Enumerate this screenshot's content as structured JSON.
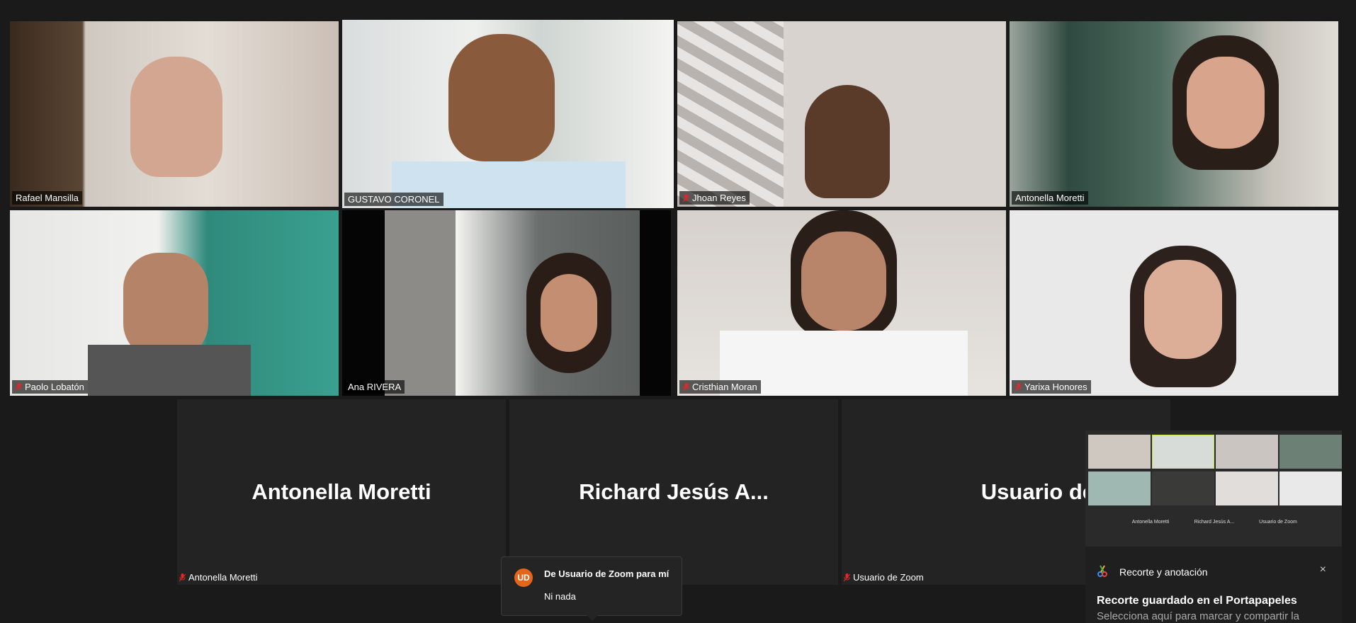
{
  "gallery": {
    "participants": [
      {
        "name": "Rafael Mansilla",
        "muted": false,
        "active": false
      },
      {
        "name": "GUSTAVO CORONEL",
        "muted": false,
        "active": true
      },
      {
        "name": "Jhoan Reyes",
        "muted": true,
        "active": false
      },
      {
        "name": "Antonella Moretti",
        "muted": false,
        "active": false
      },
      {
        "name": "Paolo Lobatón",
        "muted": true,
        "active": false
      },
      {
        "name": "Ana RIVERA",
        "muted": false,
        "active": false
      },
      {
        "name": "Cristhian Moran",
        "muted": true,
        "active": false
      },
      {
        "name": "Yarixa Honores",
        "muted": true,
        "active": false
      }
    ],
    "no_video": [
      {
        "display_name": "Antonella Moretti",
        "label": "Antonella Moretti",
        "muted": true
      },
      {
        "display_name": "Richard  Jesús  A...",
        "label": "",
        "muted": false
      },
      {
        "display_name": "Usuario de Zoom",
        "label": "Usuario de Zoom",
        "muted": true
      }
    ]
  },
  "mini_view": {
    "names": [
      "Antonella Moretti",
      "Richard Jesús A...",
      "Usuario de Zoom"
    ]
  },
  "chat_popup": {
    "avatar_initials": "UD",
    "from": "De Usuario de Zoom para mí",
    "message": "Ni nada"
  },
  "toast": {
    "app_name": "Recorte y anotación",
    "close_icon": "×",
    "title": "Recorte guardado en el Portapapeles",
    "body": "Selecciona aquí para marcar y compartir la"
  },
  "colors": {
    "active_speaker_border": "#c8e54a",
    "muted_icon": "#e02828",
    "avatar_bg": "#e3661b"
  }
}
